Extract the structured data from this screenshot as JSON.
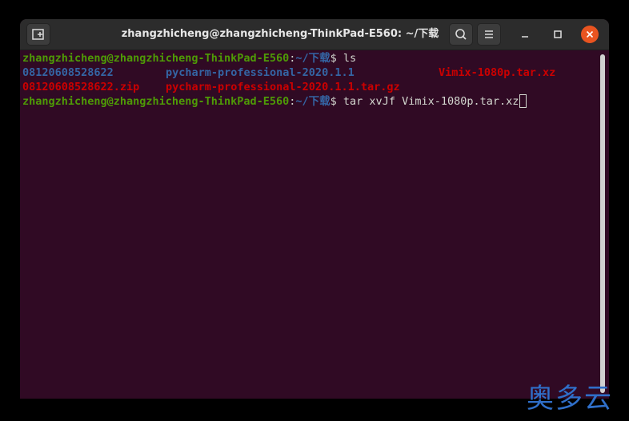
{
  "window": {
    "title": "zhangzhicheng@zhangzhicheng-ThinkPad-E560: ~/下载"
  },
  "icons": {
    "new_tab": "new-tab-icon",
    "search": "search-icon",
    "menu": "hamburger-menu-icon",
    "minimize": "minimize-icon",
    "maximize": "maximize-icon",
    "close": "close-icon"
  },
  "colors": {
    "terminal_bg": "#300a24",
    "prompt_user": "#4e9a06",
    "directory": "#3465a4",
    "archive": "#cc0000",
    "close_button": "#e95420"
  },
  "terminal": {
    "prompt_user_host": "zhangzhicheng@zhangzhicheng-ThinkPad-E560",
    "prompt_sep": ":",
    "prompt_path": "~/下载",
    "prompt_symbol": "$ ",
    "commands": [
      "ls",
      "tar xvJf Vimix-1080p.tar.xz"
    ],
    "ls_output": [
      [
        "08120608528622",
        "pycharm-professional-2020.1.1",
        "Vimix-1080p.tar.xz"
      ],
      [
        "08120608528622.zip",
        "pycharm-professional-2020.1.1.tar.gz",
        ""
      ]
    ]
  },
  "watermark": {
    "text": "奥多云"
  }
}
